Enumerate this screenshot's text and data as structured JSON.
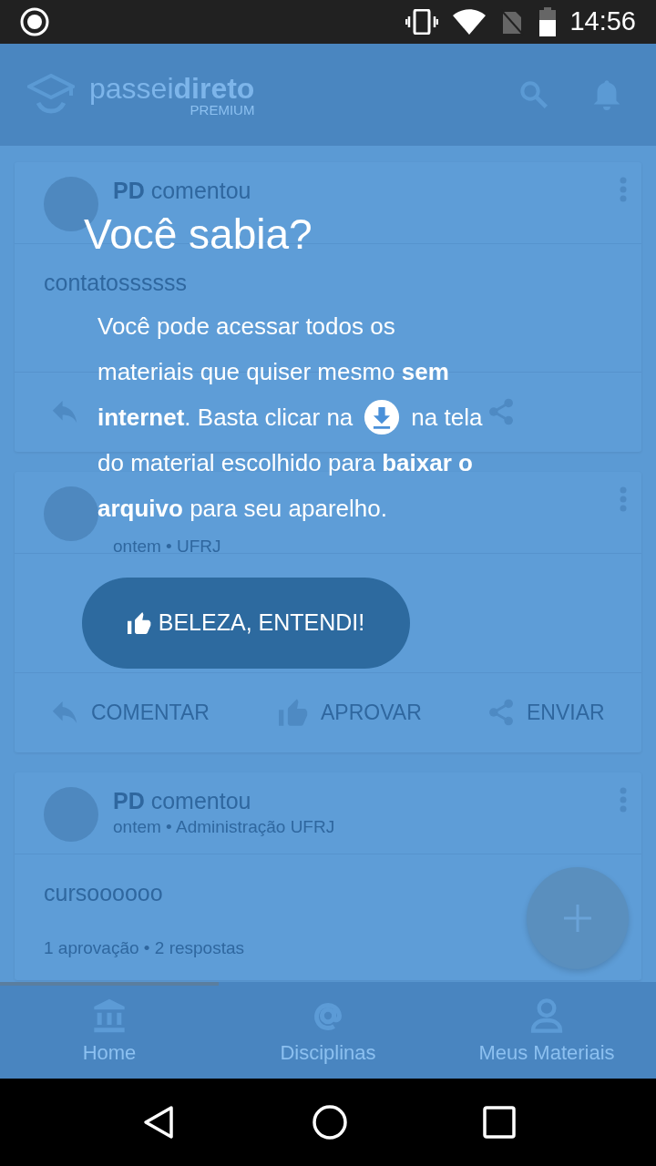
{
  "status_bar": {
    "time": "14:56"
  },
  "app_bar": {
    "logo": "passei**direto**",
    "tier": "PREMIUM"
  },
  "feed": [
    {
      "author": "**PD** comentou",
      "content": "contatossssss",
      "actions": [
        {
          "kind": "reply"
        },
        {
          "kind": "share"
        }
      ]
    },
    {
      "meta": "ontem • UFRJ",
      "actions": [
        {
          "kind": "reply",
          "label": "COMENTAR"
        },
        {
          "kind": "like",
          "label": "APROVAR"
        },
        {
          "kind": "share",
          "label": "ENVIAR"
        }
      ]
    },
    {
      "author": "**PD** comentou",
      "meta": "ontem • Administração UFRJ",
      "content": "cursoooooo",
      "stats": "1 aprovação • 2 respostas"
    }
  ],
  "bottom_nav": [
    {
      "kind": "home",
      "label": "Home",
      "selected": true
    },
    {
      "kind": "at",
      "label": "Disciplinas",
      "selected": false
    },
    {
      "kind": "person",
      "label": "Meus Materiais",
      "selected": false
    }
  ],
  "tip": {
    "title": "Você sabia?",
    "text_start": "Você pode acessar todos os materiais que quiser mesmo **sem**",
    "text_before": "**internet**. Basta clicar na",
    "text_after": "na tela",
    "text_end": "do material escolhido para **baixar o arquivo** para seu aparelho.",
    "button": "BELEZA, ENTENDI!"
  }
}
